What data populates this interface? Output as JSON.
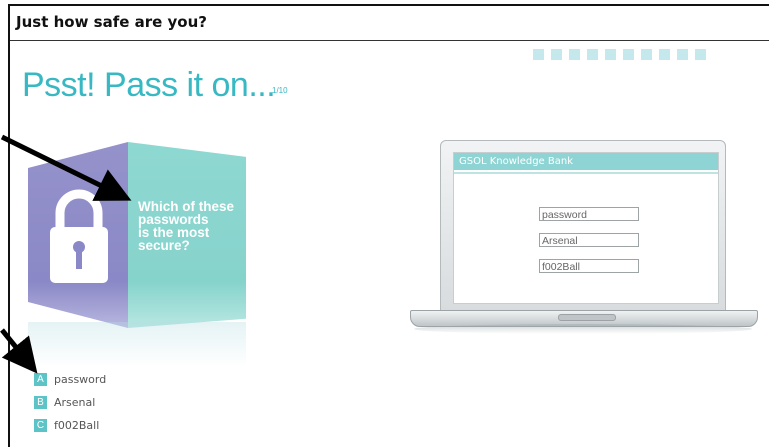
{
  "window": {
    "title": "Just how safe are you?"
  },
  "headline": "Psst! Pass it on...",
  "counter": "1/10",
  "question_lines": [
    "Which of these",
    "passwords",
    "is the most",
    "secure?"
  ],
  "options": [
    {
      "letter": "A",
      "text": "password"
    },
    {
      "letter": "B",
      "text": "Arsenal"
    },
    {
      "letter": "C",
      "text": "f002Ball"
    }
  ],
  "laptop": {
    "screen_title": "GSOL Knowledge Bank",
    "fields": [
      "password",
      "Arsenal",
      "f002Ball"
    ]
  },
  "colors": {
    "accent": "#37b8c2",
    "cube_left": "#8a88c6",
    "cube_right": "#86d3cc",
    "badge": "#5cc3c6"
  },
  "icons": [
    "padlock-icon",
    "annotation-arrow"
  ]
}
